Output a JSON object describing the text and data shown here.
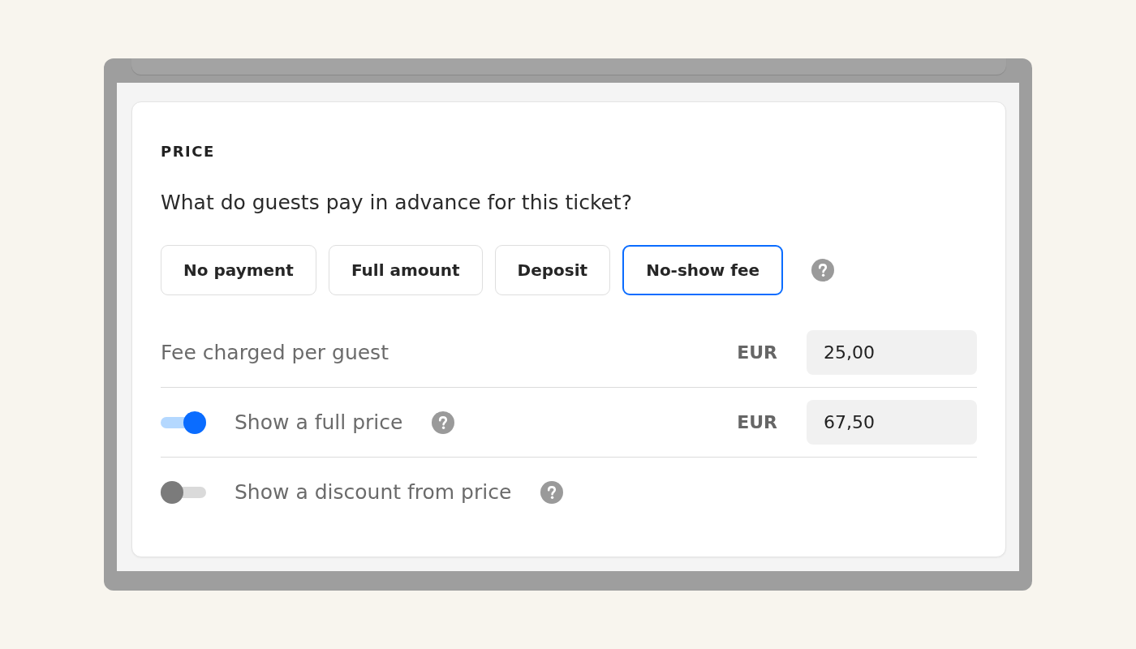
{
  "price_section": {
    "title": "PRICE",
    "question": "What do guests pay in advance for this ticket?",
    "payment_options": [
      {
        "label": "No payment",
        "selected": false
      },
      {
        "label": "Full amount",
        "selected": false
      },
      {
        "label": "Deposit",
        "selected": false
      },
      {
        "label": "No-show fee",
        "selected": true
      }
    ],
    "fee": {
      "label": "Fee charged per guest",
      "currency": "EUR",
      "value": "25,00"
    },
    "toggles": [
      {
        "label": "Show a full price",
        "on": true,
        "currency": "EUR",
        "value": "67,50"
      },
      {
        "label": "Show a discount from price",
        "on": false
      }
    ]
  }
}
